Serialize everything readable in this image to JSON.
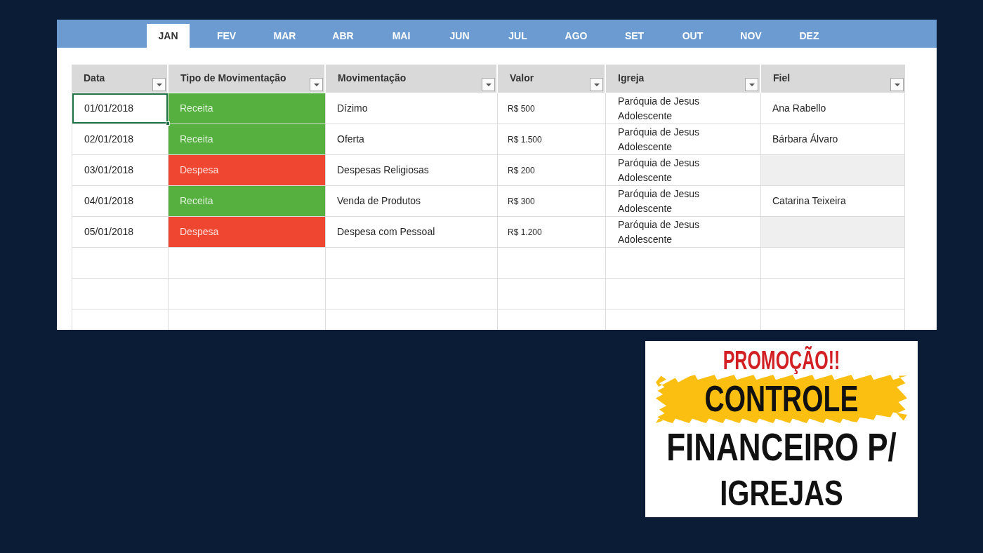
{
  "month_tabs": [
    {
      "label": "JAN",
      "selected": true
    },
    {
      "label": "FEV",
      "selected": false
    },
    {
      "label": "MAR",
      "selected": false
    },
    {
      "label": "ABR",
      "selected": false
    },
    {
      "label": "MAI",
      "selected": false
    },
    {
      "label": "JUN",
      "selected": false
    },
    {
      "label": "JUL",
      "selected": false
    },
    {
      "label": "AGO",
      "selected": false
    },
    {
      "label": "SET",
      "selected": false
    },
    {
      "label": "OUT",
      "selected": false
    },
    {
      "label": "NOV",
      "selected": false
    },
    {
      "label": "DEZ",
      "selected": false
    }
  ],
  "table": {
    "columns": [
      "Data",
      "Tipo de Movimentação",
      "Movimentação",
      "Valor",
      "Igreja",
      "Fiel"
    ],
    "rows": [
      {
        "date": "01/01/2018",
        "selected": true,
        "type": "Receita",
        "color": "#55b03f",
        "movement": "Dízimo",
        "value": "R$ 500",
        "church": "Paróquia de Jesus Adolescente",
        "member": "Ana Rabello"
      },
      {
        "date": "02/01/2018",
        "selected": false,
        "type": "Receita",
        "color": "#55b03f",
        "movement": "Oferta",
        "value": "R$ 1.500",
        "church": "Paróquia de Jesus Adolescente",
        "member": "Bárbara Álvaro"
      },
      {
        "date": "03/01/2018",
        "selected": false,
        "type": "Despesa",
        "color": "#ee4630",
        "movement": "Despesas Religiosas",
        "value": "R$ 200",
        "church": "Paróquia de Jesus Adolescente"
      },
      {
        "date": "04/01/2018",
        "selected": false,
        "type": "Receita",
        "color": "#55b03f",
        "movement": "Venda de Produtos",
        "value": "R$ 300",
        "church": "Paróquia de Jesus Adolescente",
        "member": "Catarina Teixeira"
      },
      {
        "date": "05/01/2018",
        "selected": false,
        "type": "Despesa",
        "color": "#ee4630",
        "movement": "Despesa com Pessoal",
        "value": "R$ 1.200",
        "church": "Paróquia de Jesus Adolescente"
      }
    ]
  },
  "promo": {
    "tag": "PROMOÇÃO!!",
    "highlight": "CONTROLE",
    "lines": [
      "FINANCEIRO P/",
      "IGREJAS"
    ]
  }
}
